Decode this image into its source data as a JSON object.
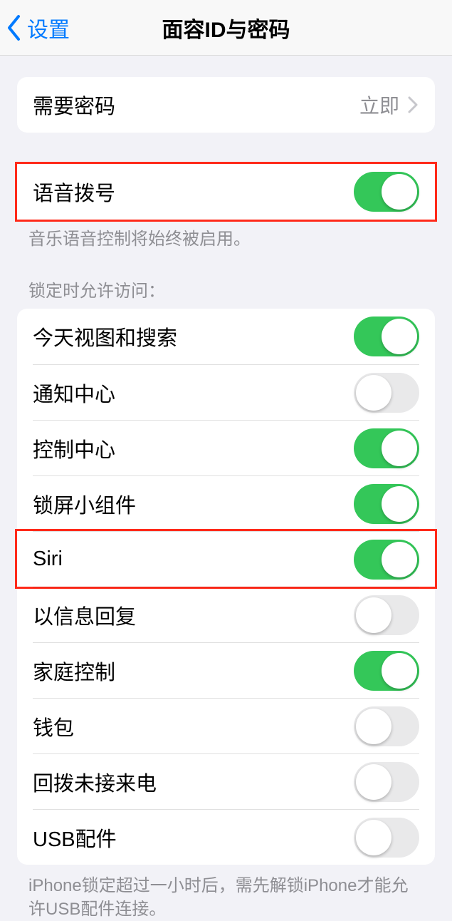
{
  "nav": {
    "back": "设置",
    "title": "面容ID与密码"
  },
  "passcode_row": {
    "label": "需要密码",
    "value": "立即"
  },
  "voice_dial": {
    "label": "语音拨号",
    "on": true
  },
  "voice_dial_note": "音乐语音控制将始终被启用。",
  "lock_header": "锁定时允许访问：",
  "lock_items": [
    {
      "label": "今天视图和搜索",
      "on": true
    },
    {
      "label": "通知中心",
      "on": false
    },
    {
      "label": "控制中心",
      "on": true
    },
    {
      "label": "锁屏小组件",
      "on": true
    },
    {
      "label": "Siri",
      "on": true
    },
    {
      "label": "以信息回复",
      "on": false
    },
    {
      "label": "家庭控制",
      "on": true
    },
    {
      "label": "钱包",
      "on": false
    },
    {
      "label": "回拨未接来电",
      "on": false
    },
    {
      "label": "USB配件",
      "on": false
    }
  ],
  "footer_note": "iPhone锁定超过一小时后，需先解锁iPhone才能允许USB配件连接。",
  "highlights": {
    "voice_dial": true,
    "siri_index": 4
  }
}
